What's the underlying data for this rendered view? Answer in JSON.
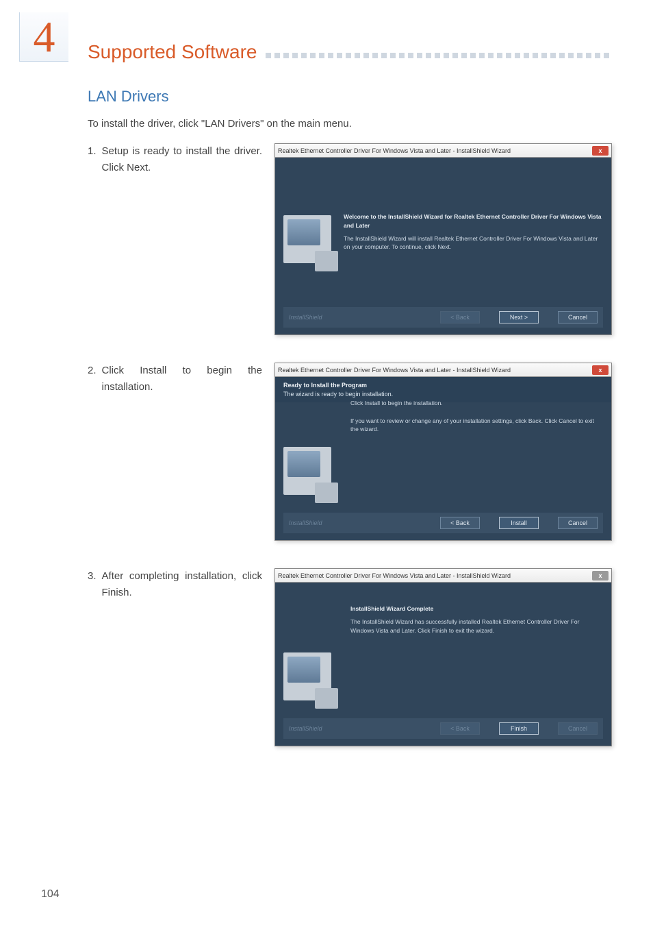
{
  "chapter": "4",
  "headerTitle": "Supported Software",
  "section": {
    "heading": "LAN Drivers",
    "intro": "To install the driver, click \"LAN Drivers\" on the main menu."
  },
  "steps": [
    {
      "num": "1.",
      "text": "Setup is ready to install the driver. Click Next."
    },
    {
      "num": "2.",
      "text": "Click Install to begin the installation."
    },
    {
      "num": "3.",
      "text": "After completing installation, click Finish."
    }
  ],
  "dialogs": {
    "d1": {
      "title": "Realtek Ethernet Controller Driver For Windows Vista and Later - InstallShield Wizard",
      "heading": "Welcome to the InstallShield Wizard for Realtek Ethernet Controller Driver For Windows Vista and Later",
      "body": "The InstallShield Wizard will install Realtek Ethernet Controller Driver For Windows Vista and Later on your computer. To continue, click Next.",
      "brand": "InstallShield",
      "buttons": {
        "back": "< Back",
        "next": "Next >",
        "cancel": "Cancel"
      }
    },
    "d2": {
      "title": "Realtek Ethernet Controller Driver For Windows Vista and Later - InstallShield Wizard",
      "subTitle": "Ready to Install the Program",
      "subDesc": "The wizard is ready to begin installation.",
      "line1": "Click Install to begin the installation.",
      "line2": "If you want to review or change any of your installation settings, click Back. Click Cancel to exit the wizard.",
      "brand": "InstallShield",
      "buttons": {
        "back": "< Back",
        "install": "Install",
        "cancel": "Cancel"
      }
    },
    "d3": {
      "title": "Realtek Ethernet Controller Driver For Windows Vista and Later - InstallShield Wizard",
      "heading": "InstallShield Wizard Complete",
      "body": "The InstallShield Wizard has successfully installed Realtek Ethernet Controller Driver For Windows Vista and Later. Click Finish to exit the wizard.",
      "brand": "InstallShield",
      "buttons": {
        "back": "< Back",
        "finish": "Finish",
        "cancel": "Cancel"
      }
    }
  },
  "pageNumber": "104"
}
